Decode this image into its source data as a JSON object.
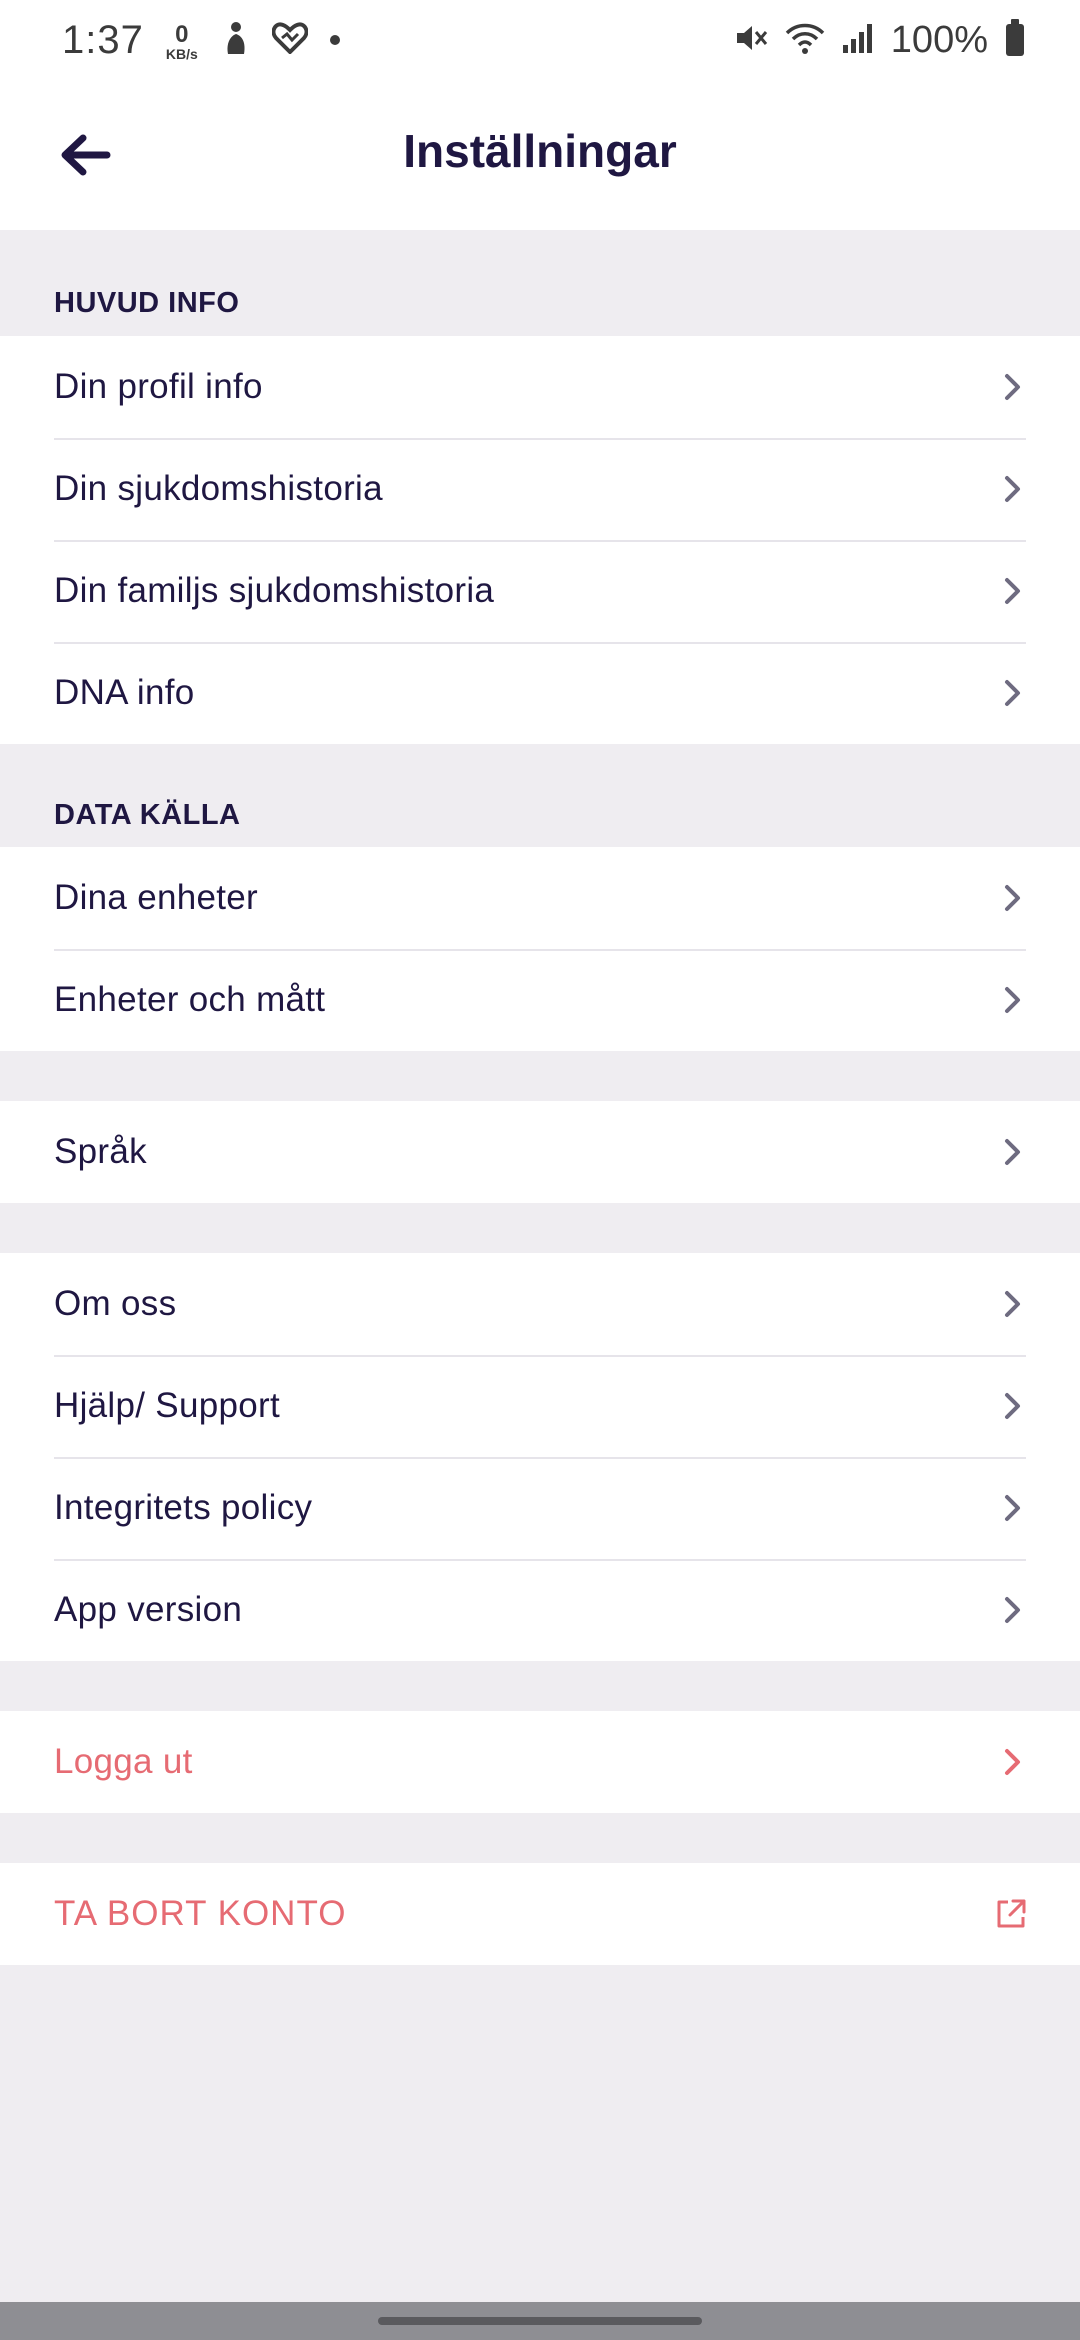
{
  "status_bar": {
    "time": "1:37",
    "net_speed_value": "0",
    "net_speed_unit": "KB/s",
    "battery": "100%"
  },
  "header": {
    "title": "Inställningar",
    "back_icon": "arrow-left-icon"
  },
  "sections": {
    "main_info": {
      "title": "HUVUD INFO",
      "items": [
        "Din profil info",
        "Din sjukdomshistoria",
        "Din familjs sjukdomshistoria",
        "DNA info"
      ]
    },
    "data_source": {
      "title": "DATA KÄLLA",
      "items": [
        "Dina enheter",
        "Enheter och mått"
      ]
    },
    "language": {
      "items": [
        "Språk"
      ]
    },
    "about": {
      "items": [
        "Om oss",
        "Hjälp/ Support",
        "Integritets policy",
        "App version"
      ]
    },
    "logout": {
      "label": "Logga ut"
    },
    "delete_account": {
      "label": "TA BORT KONTO",
      "icon": "external-link-icon"
    }
  },
  "colors": {
    "text": "#1f1742",
    "danger": "#e66b73",
    "chevron": "#6e6b80",
    "background": "#efedf1"
  }
}
